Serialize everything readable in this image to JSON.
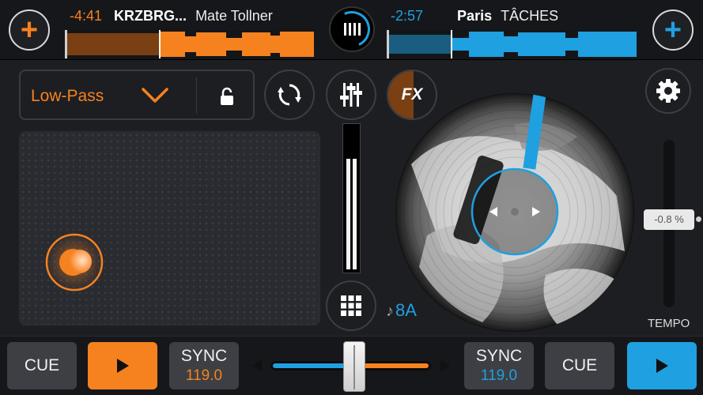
{
  "deck_a": {
    "time": "-4:41",
    "artist": "KRZBRG...",
    "title": "Mate Tollner",
    "cue_label": "CUE",
    "sync_label": "SYNC",
    "bpm": "119.0",
    "color": "#f5821f"
  },
  "deck_b": {
    "time": "-2:57",
    "artist": "Paris",
    "title": "TÂCHES",
    "cue_label": "CUE",
    "sync_label": "SYNC",
    "bpm": "119.0",
    "key": "8A",
    "color": "#1fa0e0"
  },
  "fx_panel": {
    "filter_label": "Low-Pass",
    "fx_label": "FX"
  },
  "tempo": {
    "value": "-0.8 %",
    "label": "TEMPO"
  },
  "icons": {
    "add": "plus-icon",
    "logo": "cross-dj-logo-icon",
    "chevron": "chevron-down-icon",
    "lock": "lock-icon",
    "loop": "sync-loop-icon",
    "mixer": "mixer-sliders-icon",
    "settings": "gear-icon",
    "grid": "pads-grid-icon",
    "note": "music-note-icon",
    "play": "play-icon"
  },
  "crossfader": {
    "position": 0.5
  }
}
